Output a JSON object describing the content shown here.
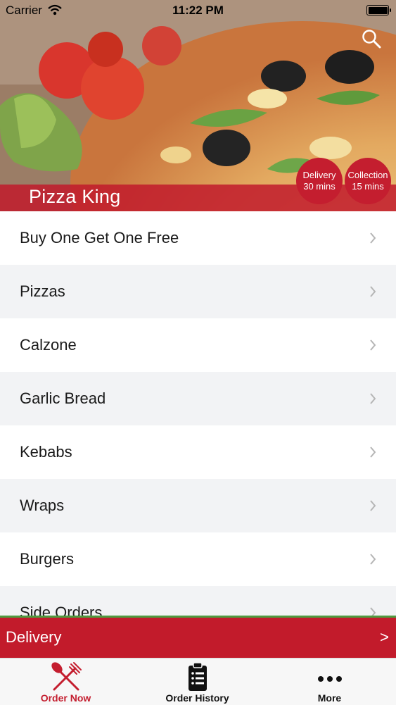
{
  "status_bar": {
    "carrier": "Carrier",
    "time": "11:22 PM"
  },
  "header": {
    "store_name": "Pizza King",
    "delivery_badge": {
      "label": "Delivery",
      "time": "30 mins"
    },
    "collection_badge": {
      "label": "Collection",
      "time": "15 mins"
    }
  },
  "menu": {
    "items": [
      {
        "label": "Buy One Get One Free"
      },
      {
        "label": "Pizzas"
      },
      {
        "label": "Calzone"
      },
      {
        "label": "Garlic Bread"
      },
      {
        "label": "Kebabs"
      },
      {
        "label": "Wraps"
      },
      {
        "label": "Burgers"
      },
      {
        "label": "Side Orders"
      }
    ]
  },
  "delivery_bar": {
    "label": "Delivery",
    "arrow": ">"
  },
  "tabbar": {
    "tabs": [
      {
        "label": "Order Now",
        "icon": "fork-knife-icon",
        "active": true
      },
      {
        "label": "Order History",
        "icon": "clipboard-list-icon",
        "active": false
      },
      {
        "label": "More",
        "icon": "more-dots-icon",
        "active": false
      }
    ]
  },
  "colors": {
    "brand_red": "#c41e2f",
    "divider_green": "#4f9a3f"
  }
}
